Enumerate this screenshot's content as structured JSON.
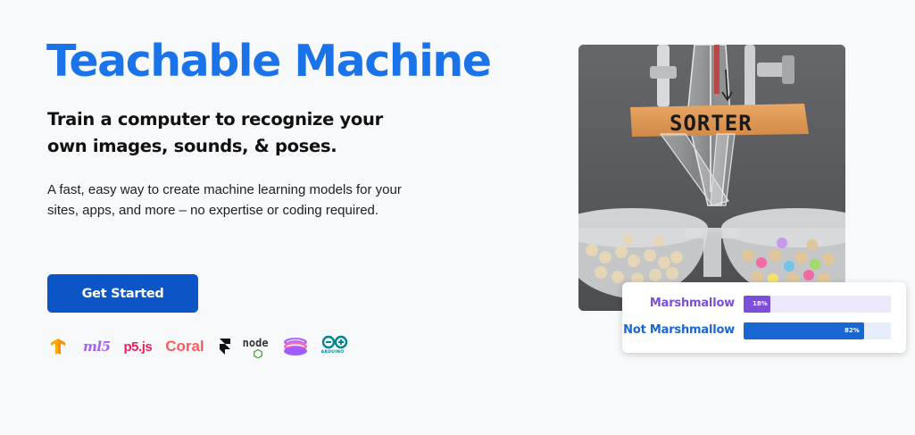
{
  "hero": {
    "title": "Teachable Machine",
    "subtitle": "Train a computer to recognize your own images, sounds, & poses.",
    "description": "A fast, easy way to create machine learning models for your sites, apps, and more – no expertise or coding required.",
    "cta_label": "Get Started"
  },
  "logos": {
    "ml5": "ml5",
    "p5": "p5.js",
    "coral": "Coral",
    "node": "node",
    "arduino": "ARDUINO"
  },
  "image": {
    "sign_text": "SORTER"
  },
  "predictions": [
    {
      "label": "Marshmallow",
      "percent_text": "18%",
      "value": 0.18,
      "color": "#7b4fd8",
      "track": "#ede7fb"
    },
    {
      "label": "Not Marshmallow",
      "percent_text": "82%",
      "value": 0.82,
      "color": "#1967d2",
      "track": "#e6eefb"
    }
  ],
  "colors": {
    "title": "#1a73e8",
    "cta": "#0c55c6"
  }
}
